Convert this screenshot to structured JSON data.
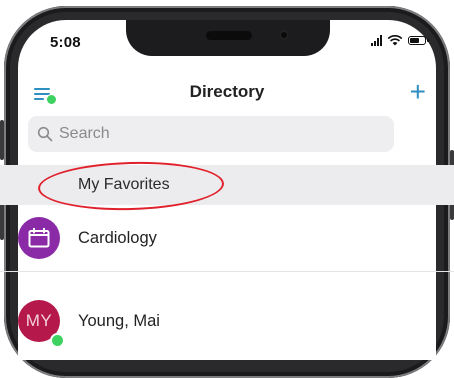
{
  "status_bar": {
    "time": "5:08"
  },
  "nav": {
    "title": "Directory",
    "menu_icon": "menu-icon",
    "add_icon": "plus-icon"
  },
  "search": {
    "placeholder": "Search",
    "value": ""
  },
  "section": {
    "label": "My Favorites",
    "annotation_color": "#e0202a"
  },
  "list": {
    "items": [
      {
        "label": "Cardiology",
        "avatar_icon": "calendar-icon",
        "avatar_color": "#8a2aa6"
      },
      {
        "label": "Young, Mai",
        "initials": "MY",
        "avatar_color": "#b5184a",
        "online": true
      }
    ]
  },
  "colors": {
    "accent": "#2f8fc0",
    "online": "#3dd15f"
  }
}
